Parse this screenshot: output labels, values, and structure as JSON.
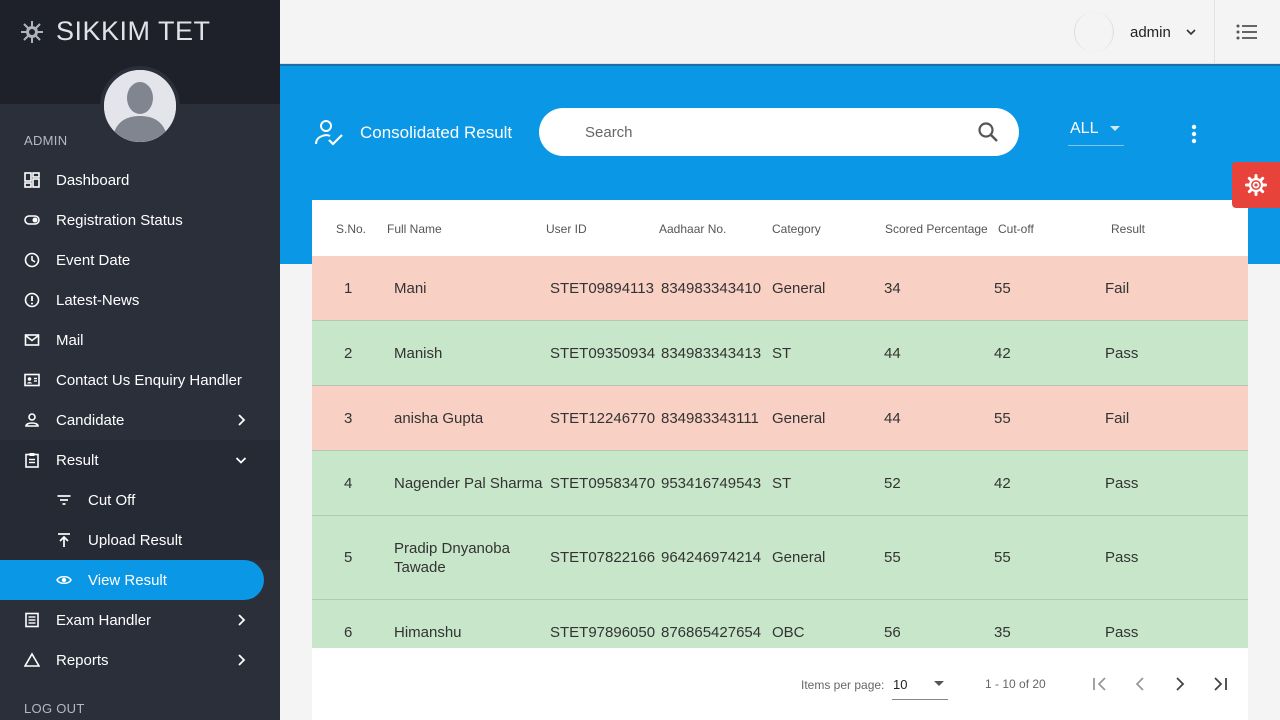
{
  "app": {
    "title": "SIKKIM TET"
  },
  "sidebar": {
    "section_admin": "ADMIN",
    "items": [
      {
        "label": "Dashboard",
        "icon": "dashboard-icon"
      },
      {
        "label": "Registration Status",
        "icon": "toggle-icon"
      },
      {
        "label": "Event Date",
        "icon": "clock-icon"
      },
      {
        "label": "Latest-News",
        "icon": "alert-circle-icon"
      },
      {
        "label": "Mail",
        "icon": "mail-icon"
      },
      {
        "label": "Contact Us Enquiry Handler",
        "icon": "contact-card-icon"
      },
      {
        "label": "Candidate",
        "icon": "person-icon"
      },
      {
        "label": "Result",
        "icon": "clipboard-icon"
      },
      {
        "label": "Cut Off",
        "icon": "filter-lines-icon"
      },
      {
        "label": "Upload Result",
        "icon": "upload-icon"
      },
      {
        "label": "View Result",
        "icon": "eye-icon"
      },
      {
        "label": "Exam Handler",
        "icon": "list-doc-icon"
      },
      {
        "label": "Reports",
        "icon": "triangle-icon"
      }
    ],
    "logout": "LOG OUT"
  },
  "topbar": {
    "user": "admin"
  },
  "header": {
    "title": "Consolidated Result",
    "search_placeholder": "Search",
    "filter_value": "ALL"
  },
  "table": {
    "columns": [
      "S.No.",
      "Full Name",
      "User ID",
      "Aadhaar No.",
      "Category",
      "Scored Percentage",
      "Cut-off",
      "Result"
    ],
    "rows": [
      {
        "sno": "1",
        "name": "Mani",
        "user_id": "STET09894113",
        "aadhaar": "834983343410",
        "category": "General",
        "score": "34",
        "cutoff": "55",
        "result": "Fail"
      },
      {
        "sno": "2",
        "name": "Manish",
        "user_id": "STET09350934",
        "aadhaar": "834983343413",
        "category": "ST",
        "score": "44",
        "cutoff": "42",
        "result": "Pass"
      },
      {
        "sno": "3",
        "name": "anisha Gupta",
        "user_id": "STET12246770",
        "aadhaar": "834983343111",
        "category": "General",
        "score": "44",
        "cutoff": "55",
        "result": "Fail"
      },
      {
        "sno": "4",
        "name": "Nagender Pal Sharma",
        "user_id": "STET09583470",
        "aadhaar": "953416749543",
        "category": "ST",
        "score": "52",
        "cutoff": "42",
        "result": "Pass"
      },
      {
        "sno": "5",
        "name": "Pradip Dnyanoba Tawade",
        "user_id": "STET07822166",
        "aadhaar": "964246974214",
        "category": "General",
        "score": "55",
        "cutoff": "55",
        "result": "Pass"
      },
      {
        "sno": "6",
        "name": "Himanshu",
        "user_id": "STET97896050",
        "aadhaar": "876865427654",
        "category": "OBC",
        "score": "56",
        "cutoff": "35",
        "result": "Pass"
      }
    ]
  },
  "paginator": {
    "items_label": "Items per page:",
    "page_size": "10",
    "range": "1 - 10 of 20"
  },
  "colors": {
    "accent": "#0a97e6",
    "sidebar_bg": "#2b2f3a",
    "fail_row": "#f8d0c4",
    "pass_row": "#c8e6c9",
    "settings_fab": "#e8433b"
  }
}
